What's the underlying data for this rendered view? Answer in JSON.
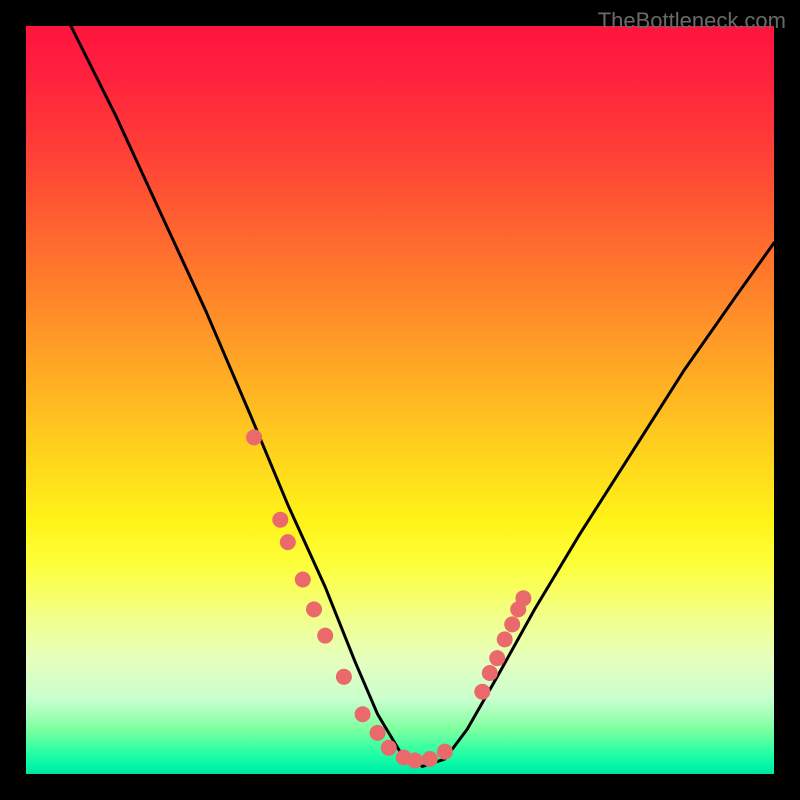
{
  "watermark": "TheBottleneck.com",
  "chart_data": {
    "type": "line",
    "title": "",
    "xlabel": "",
    "ylabel": "",
    "xlim": [
      0,
      100
    ],
    "ylim": [
      0,
      100
    ],
    "series": [
      {
        "name": "curve",
        "x": [
          6,
          12,
          18,
          24,
          30,
          35,
          40,
          44,
          47,
          50,
          53,
          56,
          59,
          63,
          68,
          74,
          81,
          88,
          95,
          100
        ],
        "values": [
          100,
          88,
          75,
          62,
          48,
          36,
          25,
          15,
          8,
          3,
          1,
          2,
          6,
          13,
          22,
          32,
          43,
          54,
          64,
          71
        ]
      }
    ],
    "scatter": [
      {
        "x": 30.5,
        "y": 45
      },
      {
        "x": 34,
        "y": 34
      },
      {
        "x": 35,
        "y": 31
      },
      {
        "x": 37,
        "y": 26
      },
      {
        "x": 38.5,
        "y": 22
      },
      {
        "x": 40,
        "y": 18.5
      },
      {
        "x": 42.5,
        "y": 13
      },
      {
        "x": 45,
        "y": 8
      },
      {
        "x": 47,
        "y": 5.5
      },
      {
        "x": 48.5,
        "y": 3.5
      },
      {
        "x": 50.5,
        "y": 2.2
      },
      {
        "x": 52,
        "y": 1.8
      },
      {
        "x": 54,
        "y": 2
      },
      {
        "x": 56,
        "y": 3
      },
      {
        "x": 61,
        "y": 11
      },
      {
        "x": 62,
        "y": 13.5
      },
      {
        "x": 63,
        "y": 15.5
      },
      {
        "x": 64,
        "y": 18
      },
      {
        "x": 65,
        "y": 20
      },
      {
        "x": 65.8,
        "y": 22
      },
      {
        "x": 66.5,
        "y": 23.5
      }
    ],
    "colors": {
      "curve_stroke": "#000000",
      "point_fill": "#ea6a6c"
    }
  }
}
